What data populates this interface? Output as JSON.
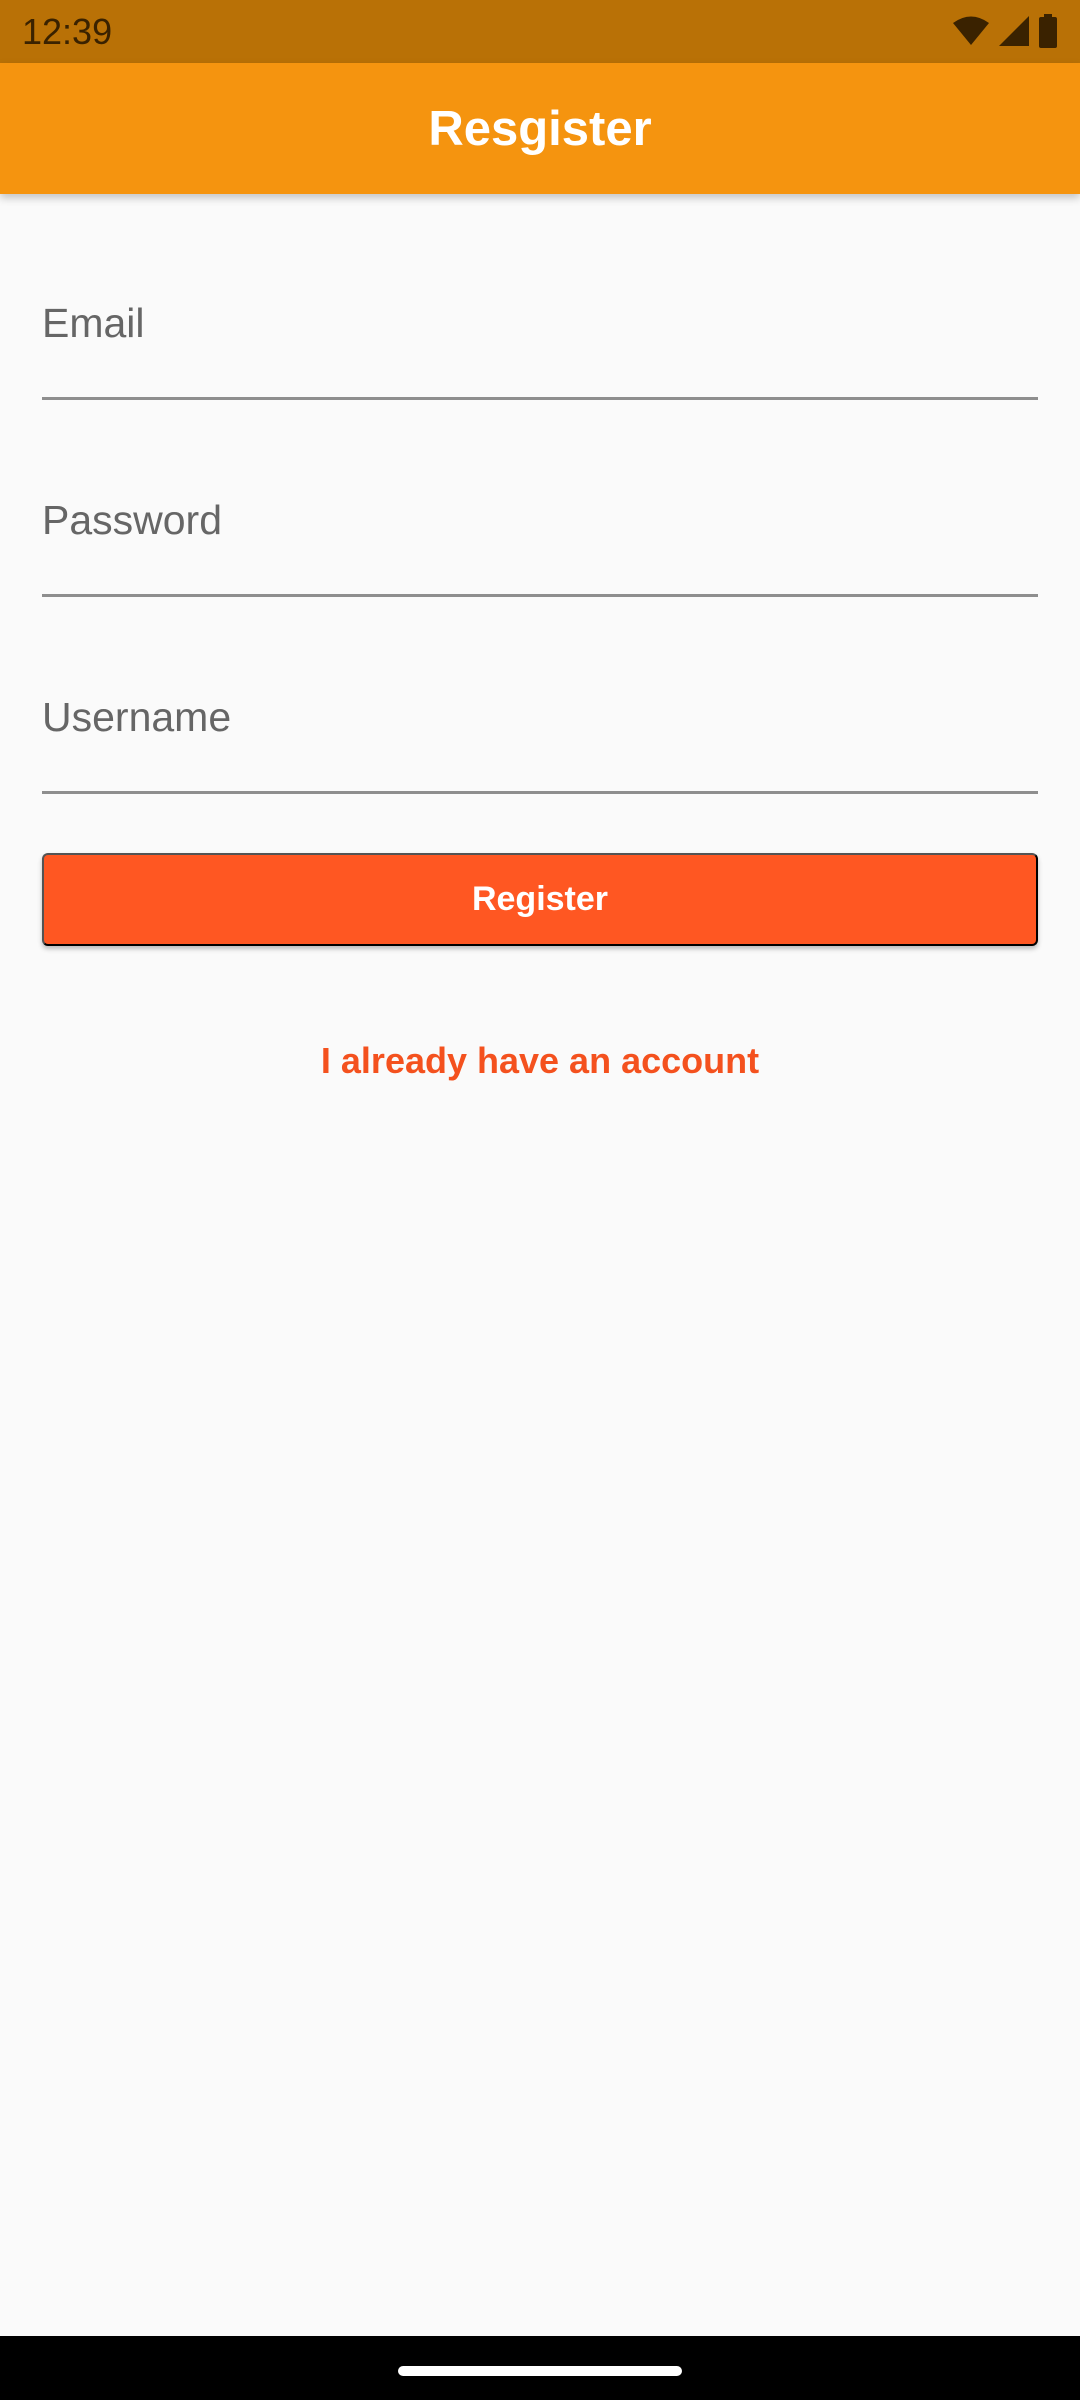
{
  "status_bar": {
    "time": "12:39",
    "icons": [
      "wifi-icon",
      "signal-icon",
      "battery-icon"
    ]
  },
  "app_bar": {
    "title": "Resgister"
  },
  "form": {
    "email": {
      "label": "Email",
      "value": ""
    },
    "password": {
      "label": "Password",
      "value": ""
    },
    "username": {
      "label": "Username",
      "value": ""
    },
    "register_label": "Register",
    "account_link": "I already have an account"
  },
  "colors": {
    "status_bar": "#b97106",
    "app_bar": "#f5940f",
    "button": "#ff5722",
    "link": "#f4511e",
    "background": "#fafafa"
  }
}
